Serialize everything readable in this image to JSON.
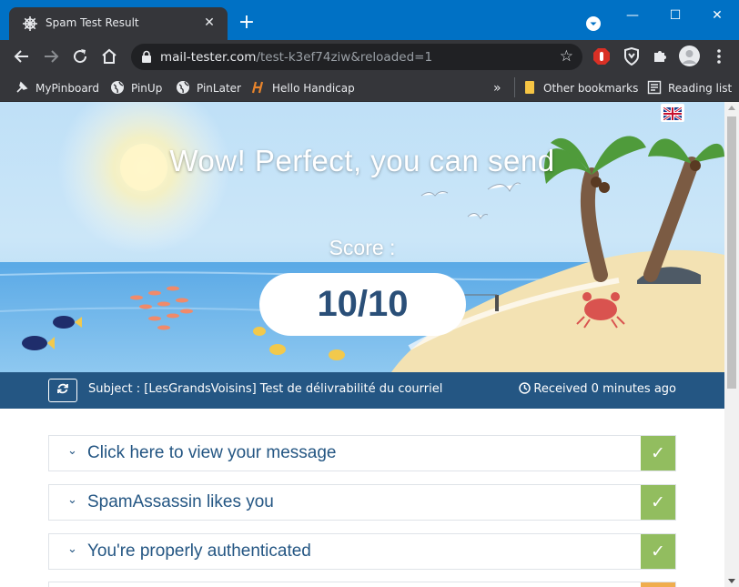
{
  "browser": {
    "tab_title": "Spam Test Result",
    "url_domain": "mail-tester.com",
    "url_path": "/test-k3ef74ziw&reloaded=1",
    "bookmarks": [
      {
        "label": "MyPinboard"
      },
      {
        "label": "PinUp"
      },
      {
        "label": "PinLater"
      },
      {
        "label": "Hello Handicap"
      }
    ],
    "overflow_label": "»",
    "other_bookmarks": "Other bookmarks",
    "reading_list": "Reading list",
    "colors": {
      "tabbar": "#0071c5",
      "toolbar": "#35363a"
    }
  },
  "hero": {
    "headline": "Wow! Perfect, you can send",
    "score_label": "Score :",
    "score_value": "10/10",
    "language_icon": "uk-flag-icon"
  },
  "subject_bar": {
    "subject": "Subject : [LesGrandsVoisins] Test de délivrabilité du courriel",
    "received": "Received 0 minutes ago",
    "color": "#245683"
  },
  "results": [
    {
      "label": "Click here to view your message",
      "status": "pass"
    },
    {
      "label": "SpamAssassin likes you",
      "status": "pass"
    },
    {
      "label": "You're properly authenticated",
      "status": "pass"
    }
  ],
  "colors": {
    "pass": "#92bd5f",
    "warning": "#f0ad4e",
    "text": "#245683"
  }
}
